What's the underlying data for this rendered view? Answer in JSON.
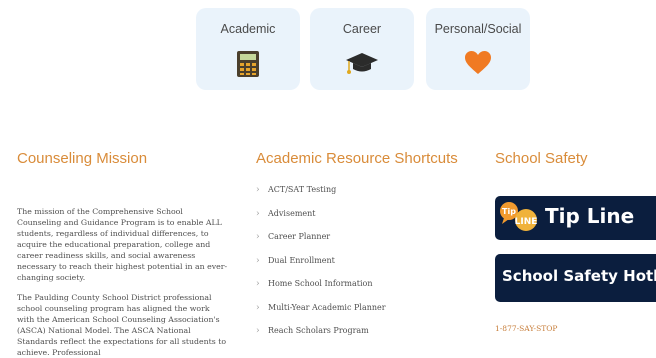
{
  "cards": [
    {
      "label": "Academic",
      "icon": "calculator-icon"
    },
    {
      "label": "Career",
      "icon": "graduation-cap-icon"
    },
    {
      "label": "Personal/Social",
      "icon": "heart-icon"
    }
  ],
  "colors": {
    "accent": "#d98c3a",
    "card_bg": "#eaf3fb",
    "navy": "#0b1e3e",
    "heart": "#f07a23"
  },
  "mission": {
    "title": "Counseling Mission",
    "paragraph1": "The mission of the Comprehensive School Counseling and Guidance Program is to enable ALL students, regardless of individual differences, to acquire the educational preparation, college and career readiness skills, and social awareness necessary to reach their highest potential in an ever-changing society.",
    "paragraph2": "The Paulding County School District professional school counseling program has aligned the work with the American School Counseling Association's (ASCA) National Model. The ASCA National Standards reflect the expectations for all students to achieve. Professional"
  },
  "shortcuts": {
    "title": "Academic Resource Shortcuts",
    "items": [
      "ACT/SAT Testing",
      "Advisement",
      "Career Planner",
      "Dual Enrollment",
      "Home School Information",
      "Multi-Year Academic Planner",
      "Reach Scholars Program"
    ]
  },
  "safety": {
    "title": "School Safety",
    "tipline": {
      "badge_top": "Tip",
      "badge_bottom": "LINE",
      "label": "Tip Line"
    },
    "hotline": {
      "label": "School Safety Hotline"
    },
    "phone": "1-877-SAY-STOP"
  }
}
